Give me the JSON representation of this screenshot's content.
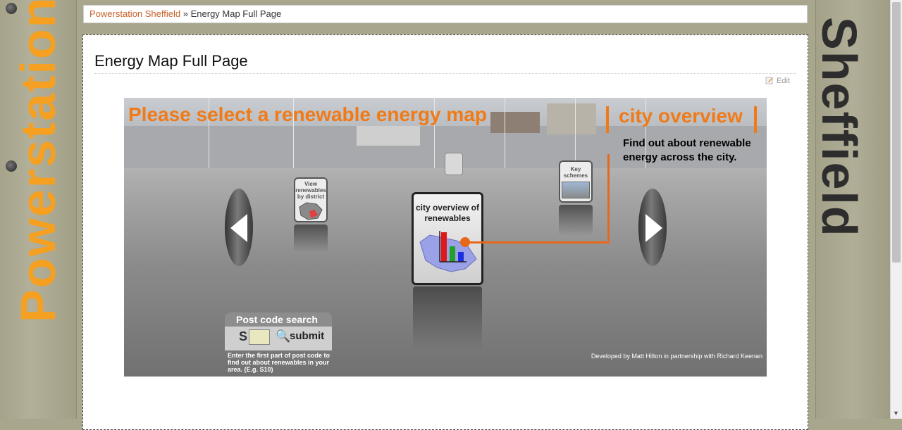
{
  "side": {
    "left_text": "Powerstation",
    "right_text": "Sheffield"
  },
  "breadcrumb": {
    "home": "Powerstation Sheffield",
    "separator": "»",
    "current": "Energy Map Full Page"
  },
  "page": {
    "title": "Energy Map Full Page",
    "edit_label": "Edit"
  },
  "map": {
    "banner_title": "Please select a renewable energy map",
    "overview_title": "city overview",
    "overview_desc": "Find out about renewable energy across the city.",
    "cards": {
      "center": "city overview of renewables",
      "left": "View renewables by district",
      "right": "Key schemes"
    },
    "postcode": {
      "heading": "Post code search",
      "prefix": "S",
      "submit": "submit",
      "help": "Enter the first part of post code to find out about renewables in your area. (E.g. S10)"
    },
    "credit": "Developed by Matt Hilton in partnership with Richard Keenan"
  },
  "colors": {
    "accent": "#f07a18",
    "link": "#c7612a",
    "side_text": "#f5a020"
  }
}
